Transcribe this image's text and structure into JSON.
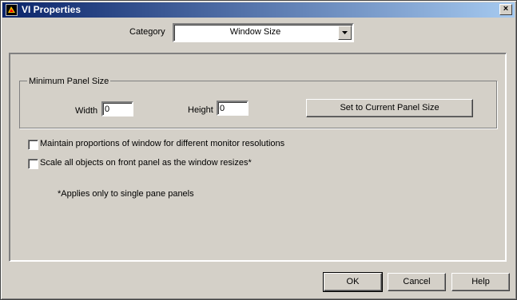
{
  "window": {
    "title": "VI Properties",
    "close_label": "×"
  },
  "category": {
    "label": "Category",
    "selected": "Window Size"
  },
  "panel_size": {
    "group_title": "Minimum Panel Size",
    "width_label": "Width",
    "width_value": "0",
    "height_label": "Height",
    "height_value": "0",
    "set_button": "Set to Current Panel Size"
  },
  "options": {
    "maintain_proportions": {
      "label": "Maintain proportions of window for different monitor resolutions",
      "checked": false
    },
    "scale_objects": {
      "label": "Scale all objects on front panel as the window resizes*",
      "checked": false
    },
    "footnote": "*Applies only to single pane panels"
  },
  "footer": {
    "ok": "OK",
    "cancel": "Cancel",
    "help": "Help"
  },
  "colors": {
    "titlebar_start": "#0a246a",
    "titlebar_end": "#a6caf0",
    "dialog_bg": "#d4d0c8"
  }
}
